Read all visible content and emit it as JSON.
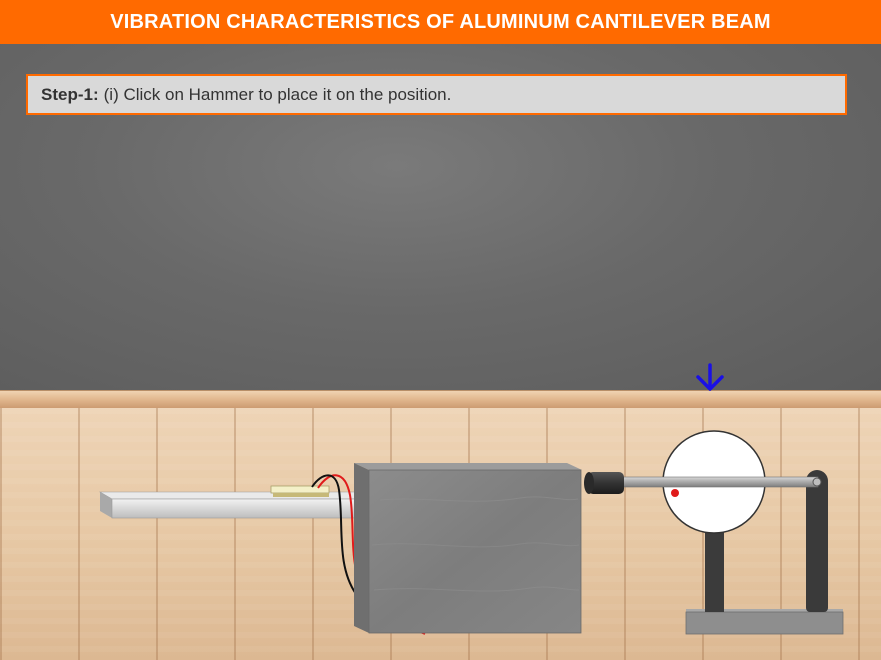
{
  "header": {
    "title": "VIBRATION CHARACTERISTICS OF ALUMINUM CANTILEVER BEAM"
  },
  "instruction": {
    "step_label": "Step-1:",
    "text": "(i) Click on Hammer to place it on the position."
  },
  "colors": {
    "accent": "#ff6a00",
    "pointer_arrow": "#1a10e6",
    "wire_red": "#e01b1b",
    "wire_black": "#111111"
  },
  "icons": {
    "pointer": "down-arrow-icon"
  }
}
